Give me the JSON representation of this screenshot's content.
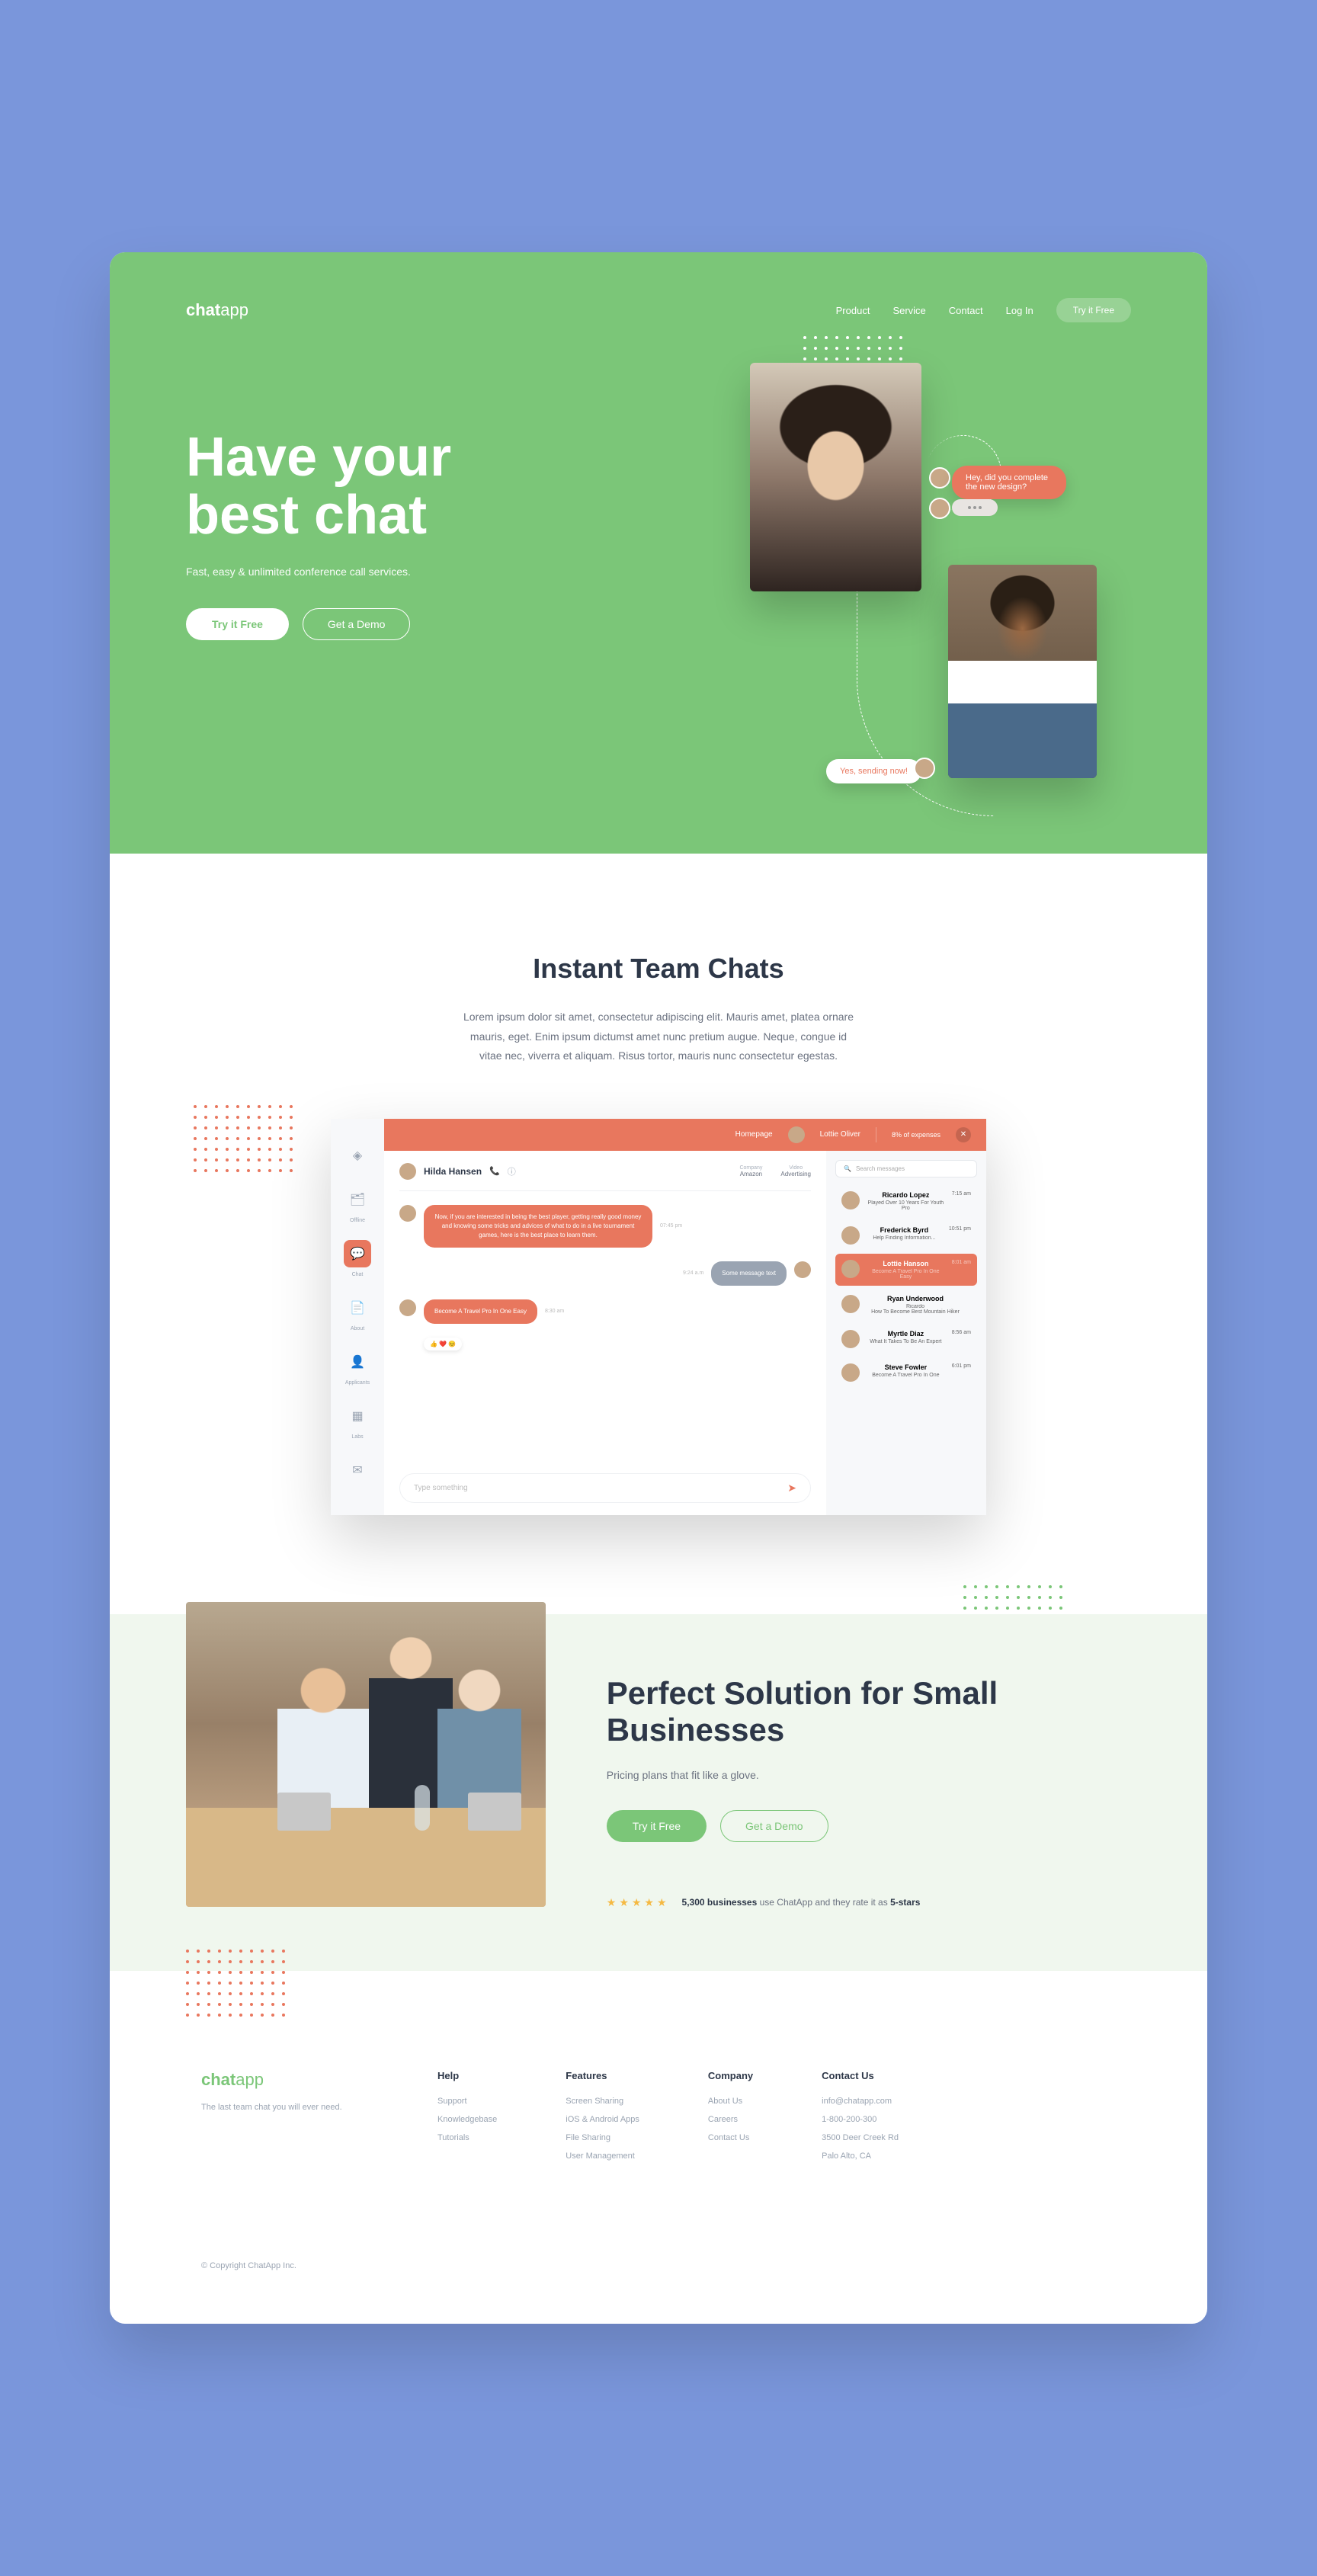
{
  "logo": {
    "bold": "chat",
    "thin": "app"
  },
  "nav": {
    "items": [
      "Product",
      "Service",
      "Contact",
      "Log In"
    ],
    "cta": "Try it Free"
  },
  "hero": {
    "title": "Have your best chat",
    "subtitle": "Fast, easy & unlimited conference call services.",
    "btn_primary": "Try it Free",
    "btn_secondary": "Get a Demo",
    "bubble1": "Hey, did you complete the new design?",
    "bubble2": "Yes, sending now!"
  },
  "sec2": {
    "title": "Instant Team Chats",
    "desc": "Lorem ipsum dolor sit amet, consectetur adipiscing elit. Mauris amet, platea ornare mauris, eget. Enim ipsum dictumst amet nunc pretium augue. Neque, congue id vitae nec, viverra et aliquam. Risus tortor, mauris nunc consectetur egestas.",
    "mock": {
      "topbar": {
        "homepage": "Homepage",
        "username": "Lottie Oliver",
        "stat": "8% of expenses"
      },
      "sidebar": [
        {
          "icon": "◈",
          "label": ""
        },
        {
          "icon": "🗂",
          "label": "Offline"
        },
        {
          "icon": "💬",
          "label": "Chat"
        },
        {
          "icon": "📄",
          "label": "About"
        },
        {
          "icon": "👤",
          "label": "Applicants"
        },
        {
          "icon": "▦",
          "label": "Labs"
        },
        {
          "icon": "✉",
          "label": ""
        }
      ],
      "chat_header": {
        "name": "Hilda Hansen",
        "company_label": "Company",
        "company": "Amazon",
        "video_label": "Video",
        "video": "Advertising"
      },
      "messages": [
        {
          "side": "left",
          "cls": "orange",
          "text": "Now, if you are interested in being the best player, getting really good money and knowing some tricks and advices of what to do in a live tournament games, here is the best place to learn them.",
          "time": "07:45 pm"
        },
        {
          "side": "right",
          "cls": "grey",
          "text": "Some message text",
          "time": "9:24 a.m"
        },
        {
          "side": "left",
          "cls": "orange",
          "text": "Become A Travel Pro In One Easy",
          "time": "8:30 am",
          "reactions": true
        }
      ],
      "input_placeholder": "Type something",
      "search_placeholder": "Search messages",
      "contacts": [
        {
          "name": "Ricardo Lopez",
          "sub": "Played Over 10 Years For Youth Pro",
          "time": "7:15 am"
        },
        {
          "name": "Frederick Byrd",
          "sub": "Help Finding Information...",
          "time": "10:51 pm"
        },
        {
          "name": "Lottie Hanson",
          "sub": "Become A Travel Pro In One Easy",
          "time": "8:01 am",
          "active": true
        },
        {
          "name": "Ryan Underwood",
          "sub": "How To Become Best Mountain Hiker",
          "time": "",
          "small": "Ricardo"
        },
        {
          "name": "Myrtle Diaz",
          "sub": "What It Takes To Be An Expert",
          "time": "8:56 am"
        },
        {
          "name": "Steve Fowler",
          "sub": "Become A Travel Pro In One",
          "time": "6:01 pm"
        }
      ]
    }
  },
  "sec3": {
    "title": "Perfect Solution for Small Businesses",
    "subtitle": "Pricing plans that fit like a glove.",
    "btn_primary": "Try it Free",
    "btn_secondary": "Get a Demo",
    "rating_bold1": "5,300 businesses",
    "rating_mid": " use ChatApp and they rate it as ",
    "rating_bold2": "5-stars"
  },
  "footer": {
    "tagline": "The last team chat you will ever need.",
    "cols": [
      {
        "title": "Help",
        "links": [
          "Support",
          "Knowledgebase",
          "Tutorials"
        ]
      },
      {
        "title": "Features",
        "links": [
          "Screen Sharing",
          "iOS & Android Apps",
          "File Sharing",
          "User Management"
        ]
      },
      {
        "title": "Company",
        "links": [
          "About Us",
          "Careers",
          "Contact Us"
        ]
      },
      {
        "title": "Contact Us",
        "links": [
          "info@chatapp.com",
          "1-800-200-300",
          "3500 Deer Creek Rd",
          "Palo Alto, CA"
        ]
      }
    ],
    "copyright": "©  Copyright ChatApp Inc."
  }
}
